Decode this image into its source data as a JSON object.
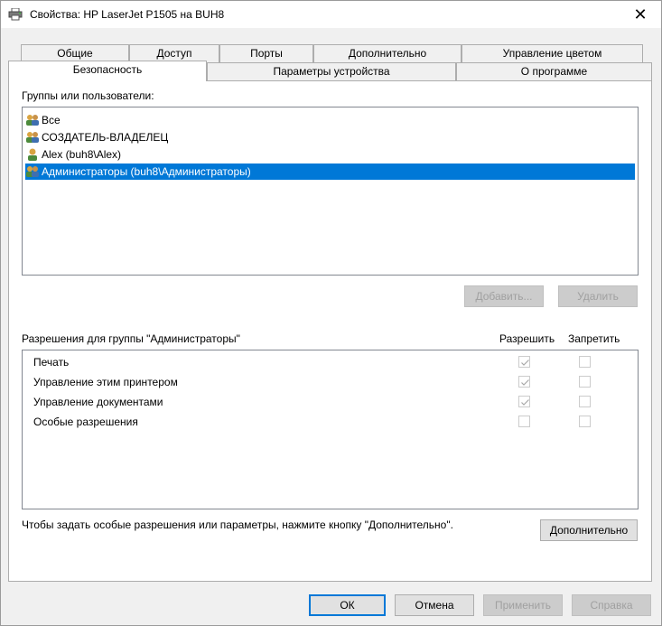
{
  "window": {
    "title": "Свойства: HP LaserJet P1505 на BUH8",
    "close_glyph": "✕"
  },
  "tabs_top": [
    {
      "label": "Общие"
    },
    {
      "label": "Доступ"
    },
    {
      "label": "Порты"
    },
    {
      "label": "Дополнительно"
    },
    {
      "label": "Управление цветом"
    }
  ],
  "tabs_bottom": [
    {
      "label": "Безопасность",
      "active": true
    },
    {
      "label": "Параметры устройства"
    },
    {
      "label": "О программе"
    }
  ],
  "groups": {
    "label": "Группы или пользователи:",
    "items": [
      {
        "label": "Все"
      },
      {
        "label": "СОЗДАТЕЛЬ-ВЛАДЕЛЕЦ"
      },
      {
        "label": "Alex (buh8\\Alex)"
      },
      {
        "label": "Администраторы (buh8\\Администраторы)",
        "selected": true
      }
    ],
    "add_button": "Добавить...",
    "remove_button": "Удалить"
  },
  "permissions": {
    "label": "Разрешения для группы \"Администраторы\"",
    "allow_header": "Разрешить",
    "deny_header": "Запретить",
    "rows": [
      {
        "label": "Печать",
        "allow": true,
        "deny": false
      },
      {
        "label": "Управление этим принтером",
        "allow": true,
        "deny": false
      },
      {
        "label": "Управление документами",
        "allow": true,
        "deny": false
      },
      {
        "label": "Особые разрешения",
        "allow": false,
        "deny": false
      }
    ]
  },
  "advanced": {
    "hint": "Чтобы задать особые разрешения или параметры, нажмите кнопку \"Дополнительно\".",
    "button": "Дополнительно"
  },
  "buttons": {
    "ok": "ОК",
    "cancel": "Отмена",
    "apply": "Применить",
    "help": "Справка"
  },
  "colors": {
    "selection": "#0078d7",
    "check_disabled": "#a8a8a8"
  }
}
